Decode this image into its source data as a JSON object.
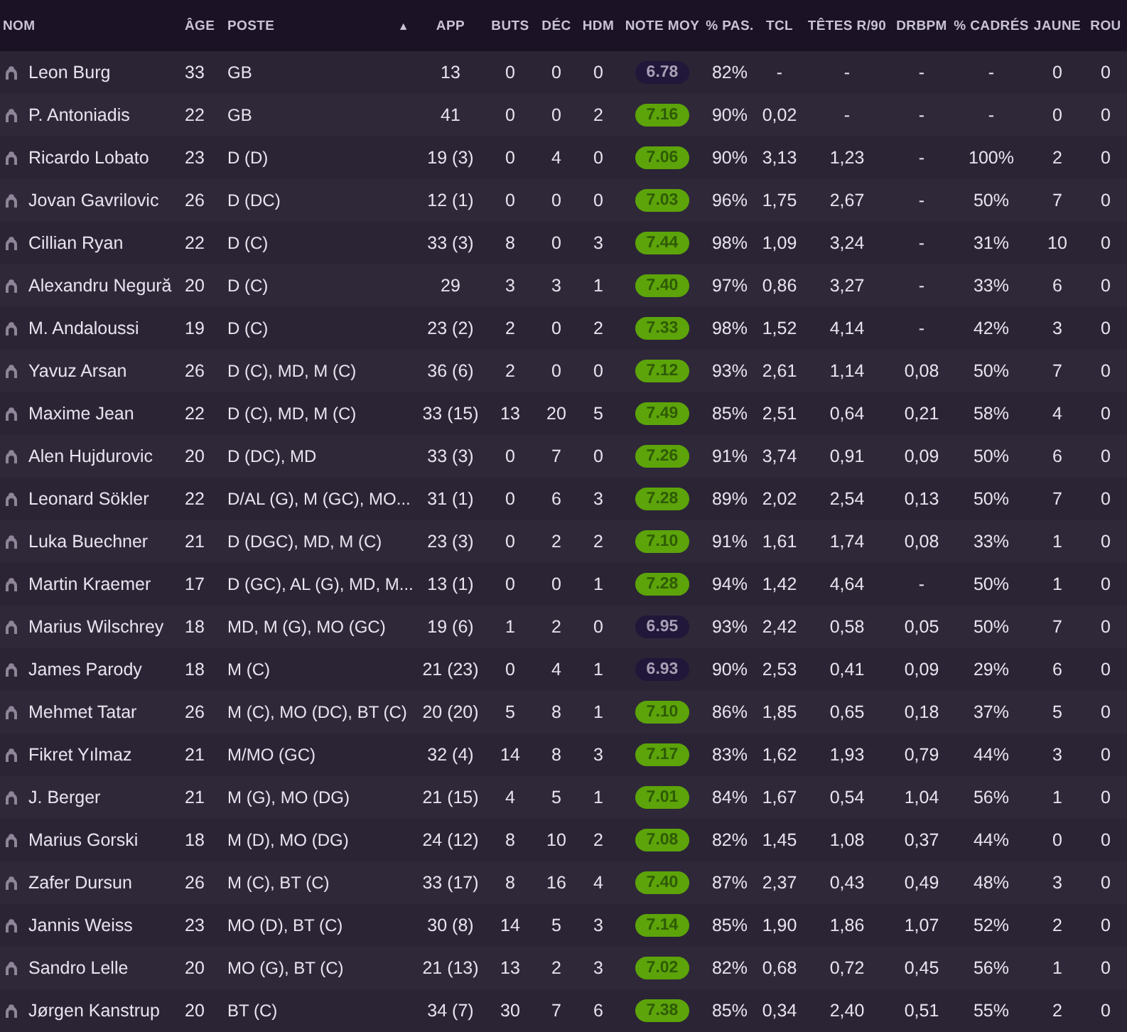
{
  "table": {
    "columns": [
      {
        "label": "NOM"
      },
      {
        "label": "ÂGE"
      },
      {
        "label": "POSTE",
        "sort_icon": "▲"
      },
      {
        "label": "APP"
      },
      {
        "label": "BUTS"
      },
      {
        "label": "DÉC"
      },
      {
        "label": "HDM"
      },
      {
        "label": "NOTE MOY"
      },
      {
        "label": "% PAS."
      },
      {
        "label": "TCL"
      },
      {
        "label": "TÊTES R/90"
      },
      {
        "label": "DRBPM"
      },
      {
        "label": "% CADRÉS"
      },
      {
        "label": "JAUNE"
      },
      {
        "label": "ROU"
      }
    ],
    "rows": [
      {
        "name": "Leon Burg",
        "age": "33",
        "position": "GB",
        "apps": "13",
        "goals": "0",
        "assists": "0",
        "pom": "0",
        "rating": "6.78",
        "rating_good": false,
        "pass_pct": "82%",
        "tackles": "-",
        "headers": "-",
        "dribbles": "-",
        "on_target": "-",
        "yellow": "0",
        "column_15": "0"
      },
      {
        "name": "P. Antoniadis",
        "age": "22",
        "position": "GB",
        "apps": "41",
        "goals": "0",
        "assists": "0",
        "pom": "2",
        "rating": "7.16",
        "rating_good": true,
        "pass_pct": "90%",
        "tackles": "0,02",
        "headers": "-",
        "dribbles": "-",
        "on_target": "-",
        "yellow": "0",
        "column_15": "0"
      },
      {
        "name": "Ricardo Lobato",
        "age": "23",
        "position": "D (D)",
        "apps": "19 (3)",
        "goals": "0",
        "assists": "4",
        "pom": "0",
        "rating": "7.06",
        "rating_good": true,
        "pass_pct": "90%",
        "tackles": "3,13",
        "headers": "1,23",
        "dribbles": "-",
        "on_target": "100%",
        "yellow": "2",
        "column_15": "0"
      },
      {
        "name": "Jovan Gavrilovic",
        "age": "26",
        "position": "D (DC)",
        "apps": "12 (1)",
        "goals": "0",
        "assists": "0",
        "pom": "0",
        "rating": "7.03",
        "rating_good": true,
        "pass_pct": "96%",
        "tackles": "1,75",
        "headers": "2,67",
        "dribbles": "-",
        "on_target": "50%",
        "yellow": "7",
        "column_15": "0"
      },
      {
        "name": "Cillian Ryan",
        "age": "22",
        "position": "D (C)",
        "apps": "33 (3)",
        "goals": "8",
        "assists": "0",
        "pom": "3",
        "rating": "7.44",
        "rating_good": true,
        "pass_pct": "98%",
        "tackles": "1,09",
        "headers": "3,24",
        "dribbles": "-",
        "on_target": "31%",
        "yellow": "10",
        "column_15": "0"
      },
      {
        "name": "Alexandru Negură",
        "age": "20",
        "position": "D (C)",
        "apps": "29",
        "goals": "3",
        "assists": "3",
        "pom": "1",
        "rating": "7.40",
        "rating_good": true,
        "pass_pct": "97%",
        "tackles": "0,86",
        "headers": "3,27",
        "dribbles": "-",
        "on_target": "33%",
        "yellow": "6",
        "column_15": "0"
      },
      {
        "name": "M. Andaloussi",
        "age": "19",
        "position": "D (C)",
        "apps": "23 (2)",
        "goals": "2",
        "assists": "0",
        "pom": "2",
        "rating": "7.33",
        "rating_good": true,
        "pass_pct": "98%",
        "tackles": "1,52",
        "headers": "4,14",
        "dribbles": "-",
        "on_target": "42%",
        "yellow": "3",
        "column_15": "0"
      },
      {
        "name": "Yavuz Arsan",
        "age": "26",
        "position": "D (C), MD, M (C)",
        "apps": "36 (6)",
        "goals": "2",
        "assists": "0",
        "pom": "0",
        "rating": "7.12",
        "rating_good": true,
        "pass_pct": "93%",
        "tackles": "2,61",
        "headers": "1,14",
        "dribbles": "0,08",
        "on_target": "50%",
        "yellow": "7",
        "column_15": "0"
      },
      {
        "name": "Maxime Jean",
        "age": "22",
        "position": "D (C), MD, M (C)",
        "apps": "33 (15)",
        "goals": "13",
        "assists": "20",
        "pom": "5",
        "rating": "7.49",
        "rating_good": true,
        "pass_pct": "85%",
        "tackles": "2,51",
        "headers": "0,64",
        "dribbles": "0,21",
        "on_target": "58%",
        "yellow": "4",
        "column_15": "0"
      },
      {
        "name": "Alen Hujdurovic",
        "age": "20",
        "position": "D (DC), MD",
        "apps": "33 (3)",
        "goals": "0",
        "assists": "7",
        "pom": "0",
        "rating": "7.26",
        "rating_good": true,
        "pass_pct": "91%",
        "tackles": "3,74",
        "headers": "0,91",
        "dribbles": "0,09",
        "on_target": "50%",
        "yellow": "6",
        "column_15": "0"
      },
      {
        "name": "Leonard Sökler",
        "age": "22",
        "position": "D/AL (G), M (GC), MO...",
        "apps": "31 (1)",
        "goals": "0",
        "assists": "6",
        "pom": "3",
        "rating": "7.28",
        "rating_good": true,
        "pass_pct": "89%",
        "tackles": "2,02",
        "headers": "2,54",
        "dribbles": "0,13",
        "on_target": "50%",
        "yellow": "7",
        "column_15": "0"
      },
      {
        "name": "Luka Buechner",
        "age": "21",
        "position": "D (DGC), MD, M (C)",
        "apps": "23 (3)",
        "goals": "0",
        "assists": "2",
        "pom": "2",
        "rating": "7.10",
        "rating_good": true,
        "pass_pct": "91%",
        "tackles": "1,61",
        "headers": "1,74",
        "dribbles": "0,08",
        "on_target": "33%",
        "yellow": "1",
        "column_15": "0"
      },
      {
        "name": "Martin Kraemer",
        "age": "17",
        "position": "D (GC), AL (G), MD, M...",
        "apps": "13 (1)",
        "goals": "0",
        "assists": "0",
        "pom": "1",
        "rating": "7.28",
        "rating_good": true,
        "pass_pct": "94%",
        "tackles": "1,42",
        "headers": "4,64",
        "dribbles": "-",
        "on_target": "50%",
        "yellow": "1",
        "column_15": "0"
      },
      {
        "name": "Marius Wilschrey",
        "age": "18",
        "position": "MD, M (G), MO (GC)",
        "apps": "19 (6)",
        "goals": "1",
        "assists": "2",
        "pom": "0",
        "rating": "6.95",
        "rating_good": false,
        "pass_pct": "93%",
        "tackles": "2,42",
        "headers": "0,58",
        "dribbles": "0,05",
        "on_target": "50%",
        "yellow": "7",
        "column_15": "0"
      },
      {
        "name": "James Parody",
        "age": "18",
        "position": "M (C)",
        "apps": "21 (23)",
        "goals": "0",
        "assists": "4",
        "pom": "1",
        "rating": "6.93",
        "rating_good": false,
        "pass_pct": "90%",
        "tackles": "2,53",
        "headers": "0,41",
        "dribbles": "0,09",
        "on_target": "29%",
        "yellow": "6",
        "column_15": "0"
      },
      {
        "name": "Mehmet Tatar",
        "age": "26",
        "position": "M (C), MO (DC), BT (C)",
        "apps": "20 (20)",
        "goals": "5",
        "assists": "8",
        "pom": "1",
        "rating": "7.10",
        "rating_good": true,
        "pass_pct": "86%",
        "tackles": "1,85",
        "headers": "0,65",
        "dribbles": "0,18",
        "on_target": "37%",
        "yellow": "5",
        "column_15": "0"
      },
      {
        "name": "Fikret Yılmaz",
        "age": "21",
        "position": "M/MO (GC)",
        "apps": "32 (4)",
        "goals": "14",
        "assists": "8",
        "pom": "3",
        "rating": "7.17",
        "rating_good": true,
        "pass_pct": "83%",
        "tackles": "1,62",
        "headers": "1,93",
        "dribbles": "0,79",
        "on_target": "44%",
        "yellow": "3",
        "column_15": "0"
      },
      {
        "name": "J. Berger",
        "age": "21",
        "position": "M (G), MO (DG)",
        "apps": "21 (15)",
        "goals": "4",
        "assists": "5",
        "pom": "1",
        "rating": "7.01",
        "rating_good": true,
        "pass_pct": "84%",
        "tackles": "1,67",
        "headers": "0,54",
        "dribbles": "1,04",
        "on_target": "56%",
        "yellow": "1",
        "column_15": "0"
      },
      {
        "name": "Marius Gorski",
        "age": "18",
        "position": "M (D), MO (DG)",
        "apps": "24 (12)",
        "goals": "8",
        "assists": "10",
        "pom": "2",
        "rating": "7.08",
        "rating_good": true,
        "pass_pct": "82%",
        "tackles": "1,45",
        "headers": "1,08",
        "dribbles": "0,37",
        "on_target": "44%",
        "yellow": "0",
        "column_15": "0"
      },
      {
        "name": "Zafer Dursun",
        "age": "26",
        "position": "M (C), BT (C)",
        "apps": "33 (17)",
        "goals": "8",
        "assists": "16",
        "pom": "4",
        "rating": "7.40",
        "rating_good": true,
        "pass_pct": "87%",
        "tackles": "2,37",
        "headers": "0,43",
        "dribbles": "0,49",
        "on_target": "48%",
        "yellow": "3",
        "column_15": "0"
      },
      {
        "name": "Jannis Weiss",
        "age": "23",
        "position": "MO (D), BT (C)",
        "apps": "30 (8)",
        "goals": "14",
        "assists": "5",
        "pom": "3",
        "rating": "7.14",
        "rating_good": true,
        "pass_pct": "85%",
        "tackles": "1,90",
        "headers": "1,86",
        "dribbles": "1,07",
        "on_target": "52%",
        "yellow": "2",
        "column_15": "0"
      },
      {
        "name": "Sandro Lelle",
        "age": "20",
        "position": "MO (G), BT (C)",
        "apps": "21 (13)",
        "goals": "13",
        "assists": "2",
        "pom": "3",
        "rating": "7.02",
        "rating_good": true,
        "pass_pct": "82%",
        "tackles": "0,68",
        "headers": "0,72",
        "dribbles": "0,45",
        "on_target": "56%",
        "yellow": "1",
        "column_15": "0"
      },
      {
        "name": "Jørgen Kanstrup",
        "age": "20",
        "position": "BT (C)",
        "apps": "34 (7)",
        "goals": "30",
        "assists": "7",
        "pom": "6",
        "rating": "7.38",
        "rating_good": true,
        "pass_pct": "85%",
        "tackles": "0,34",
        "headers": "2,40",
        "dribbles": "0,51",
        "on_target": "55%",
        "yellow": "2",
        "column_15": "0"
      }
    ]
  }
}
